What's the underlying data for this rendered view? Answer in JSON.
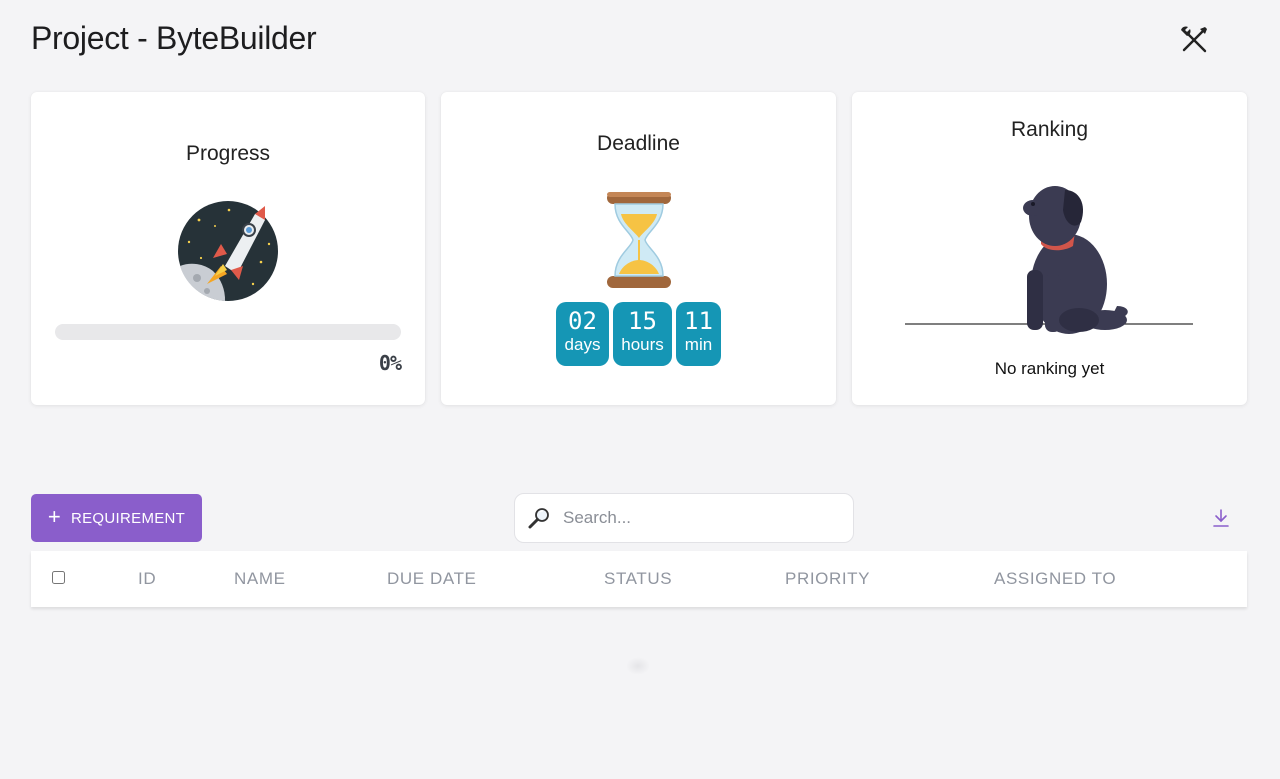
{
  "header": {
    "title": "Project - ByteBuilder",
    "tools_icon": "tools-icon"
  },
  "cards": {
    "progress": {
      "title": "Progress",
      "illustration": "rocket-illustration",
      "value_label": "0%",
      "fraction": 0
    },
    "deadline": {
      "title": "Deadline",
      "illustration": "hourglass-icon",
      "countdown": [
        {
          "value": "02",
          "unit": "days"
        },
        {
          "value": "15",
          "unit": "hours"
        },
        {
          "value": "11",
          "unit": "min"
        }
      ]
    },
    "ranking": {
      "title": "Ranking",
      "illustration": "dog-illustration",
      "empty_text": "No ranking yet"
    }
  },
  "toolbar": {
    "add_label": "REQUIREMENT",
    "add_icon": "plus-icon",
    "search_placeholder": "Search...",
    "search_icon": "magnifier-icon",
    "download_icon": "download-icon"
  },
  "table": {
    "columns": [
      "ID",
      "NAME",
      "DUE DATE",
      "STATUS",
      "PRIORITY",
      "ASSIGNED TO"
    ],
    "rows": []
  },
  "colors": {
    "accent": "#8a5ecb",
    "countdown": "#1596b5",
    "background": "#f4f4f6"
  }
}
